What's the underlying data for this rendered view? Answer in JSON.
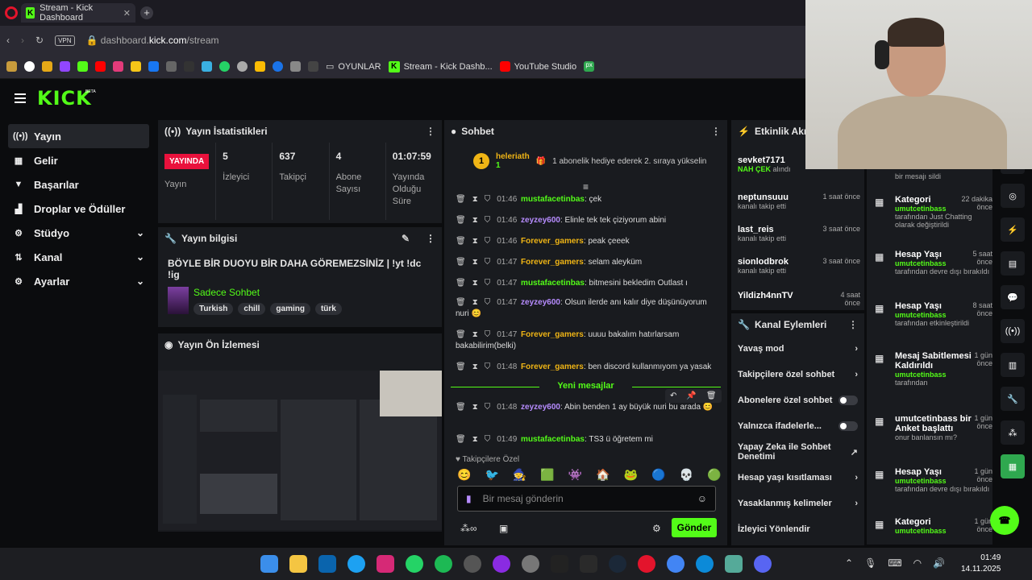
{
  "browser": {
    "tab_title": "Stream - Kick Dashboard",
    "url_host": "dashboard.",
    "url_domain": "kick.com",
    "url_path": "/stream",
    "vpn": "VPN",
    "bookmarks": [
      "OYUNLAR",
      "Stream - Kick Dashb...",
      "YouTube Studio"
    ]
  },
  "logo": "KICK",
  "beta": "BETA",
  "sidebar": {
    "items": [
      {
        "label": "Yayın",
        "icon": "broadcast-icon",
        "glyph": "((•))"
      },
      {
        "label": "Gelir",
        "icon": "revenue-icon",
        "glyph": "▦"
      },
      {
        "label": "Başarılar",
        "icon": "trophy-icon",
        "glyph": "🏆"
      },
      {
        "label": "Droplar ve Ödüller",
        "icon": "drops-icon",
        "glyph": "▟"
      },
      {
        "label": "Stüdyo",
        "icon": "studio-icon",
        "glyph": "⚙"
      },
      {
        "label": "Kanal",
        "icon": "channel-icon",
        "glyph": "⇅"
      },
      {
        "label": "Ayarlar",
        "icon": "settings-icon",
        "glyph": "⚙"
      }
    ]
  },
  "stats": {
    "title": "Yayın İstatistikleri",
    "live": "YAYINDA",
    "live_label": "Yayın",
    "items": [
      {
        "value": "5",
        "label": "İzleyici"
      },
      {
        "value": "637",
        "label": "Takipçi"
      },
      {
        "value": "4",
        "label": "Abone Sayısı"
      },
      {
        "value": "01:07:59",
        "label": "Yayında Olduğu Süre"
      }
    ]
  },
  "info": {
    "title": "Yayın bilgisi",
    "stream_title": "BÖYLE BİR DUOYU BİR DAHA GÖREMEZSİNİZ | !yt !dc !ig",
    "category": "Sadece Sohbet",
    "tags": [
      "Turkish",
      "chill",
      "gaming",
      "türk"
    ]
  },
  "preview": {
    "title": "Yayın Ön İzlemesi"
  },
  "chat": {
    "title": "Sohbet",
    "pinned_user": "heleriath",
    "pinned_badge": "1",
    "pinned_count": "1",
    "pinned_text": "1 abonelik hediye ederek 2. sıraya yükselin",
    "messages": [
      {
        "time": "01:46",
        "user": "mustafacetinbas",
        "text": "çek",
        "cls": "u1"
      },
      {
        "time": "01:46",
        "user": "zeyzey600",
        "text": "Elinle tek tek çiziyorum abini",
        "cls": "u2"
      },
      {
        "time": "01:46",
        "user": "Forever_gamers",
        "text": "peak çeeek",
        "cls": "u3"
      },
      {
        "time": "01:47",
        "user": "Forever_gamers",
        "text": "selam aleyküm",
        "cls": "u3"
      },
      {
        "time": "01:47",
        "user": "mustafacetinbas",
        "text": "bitmesini bekledim Outlast ı",
        "cls": "u1"
      },
      {
        "time": "01:47",
        "user": "zeyzey600",
        "text": "Olsun ilerde anı kalır diye düşünüyorum nuri 😊",
        "cls": "u2"
      },
      {
        "time": "01:47",
        "user": "Forever_gamers",
        "text": "uuuu bakalım hatırlarsam bakabilirim(belki)",
        "cls": "u3"
      },
      {
        "time": "01:48",
        "user": "Forever_gamers",
        "text": "ben discord kullanmıyom ya yasak",
        "cls": "u3"
      },
      {
        "time": "01:48",
        "user": "zeyzey600",
        "text": "Abin benden 1 ay büyük nuri bu arada 😊",
        "cls": "u2"
      },
      {
        "time": "01:49",
        "user": "mustafacetinbas",
        "text": "TS3 ü öğretem mi",
        "cls": "u1"
      }
    ],
    "new_messages": "Yeni mesajlar",
    "emote_label": "Takipçilere Özel",
    "placeholder": "Bir mesaj gönderin",
    "send": "Gönder"
  },
  "activity": {
    "title": "Etkinlik Akışı",
    "items": [
      {
        "name": "sevket7171",
        "sub": "alındı",
        "highlight": "NAH ÇEK",
        "time": ""
      },
      {
        "name": "neptunsuuu",
        "sub": "kanalı takip etti",
        "time": "1 saat önce"
      },
      {
        "name": "last_reis",
        "sub": "kanalı takip etti",
        "time": "3 saat önce"
      },
      {
        "name": "sionlodbrok",
        "sub": "kanalı takip etti",
        "time": "3 saat önce"
      },
      {
        "name": "Yildizh4nnTV",
        "sub": "",
        "time": "4 saat önce"
      }
    ]
  },
  "channel_actions": {
    "title": "Kanal Eylemleri",
    "items": [
      {
        "label": "Yavaş mod",
        "type": "chevron"
      },
      {
        "label": "Takipçilere özel sohbet",
        "type": "chevron"
      },
      {
        "label": "Abonelere özel sohbet",
        "type": "toggle"
      },
      {
        "label": "Yalnızca ifadelerle...",
        "type": "toggle"
      },
      {
        "label": "Yapay Zeka ile Sohbet Denetimi",
        "type": "ext"
      },
      {
        "label": "Hesap yaşı kısıtlaması",
        "type": "chevron"
      },
      {
        "label": "Yasaklanmış kelimeler",
        "type": "chevron"
      },
      {
        "label": "İzleyici Yönlendir",
        "type": "none"
      }
    ]
  },
  "events": [
    {
      "title": "",
      "green": "",
      "desc": "bir mesajı sildi",
      "time": ""
    },
    {
      "title": "Kategori",
      "green": "umutcetinbass",
      "desc": "tarafından Just Chatting olarak değiştirildi",
      "time": "22 dakika önce"
    },
    {
      "title": "Hesap Yaşı",
      "green": "umutcetinbass",
      "desc": "tarafından devre dışı bırakıldı",
      "time": "5 saat önce"
    },
    {
      "title": "Hesap Yaşı",
      "green": "umutcetinbass",
      "desc": "tarafından etkinleştirildi",
      "time": "8 saat önce"
    },
    {
      "title": "Mesaj Sabitlemesi Kaldırıldı",
      "green": "umutcetinbass",
      "desc": "tarafından",
      "time": "1 gün önce"
    },
    {
      "title": "umutcetinbass bir Anket başlattı",
      "green": "",
      "desc": "onur banlansın mı?",
      "time": "1 gün önce"
    },
    {
      "title": "Hesap Yaşı",
      "green": "umutcetinbass",
      "desc": "tarafından devre dışı bırakıldı",
      "time": "1 gün önce"
    },
    {
      "title": "Kategori",
      "green": "umutcetinbass",
      "desc": "",
      "time": "1 gün önce"
    }
  ],
  "clock": {
    "time": "01:49",
    "date": "14.11.2025"
  },
  "colors": {
    "accent": "#53fc18",
    "live": "#e9113c",
    "panel": "#191b1f"
  }
}
